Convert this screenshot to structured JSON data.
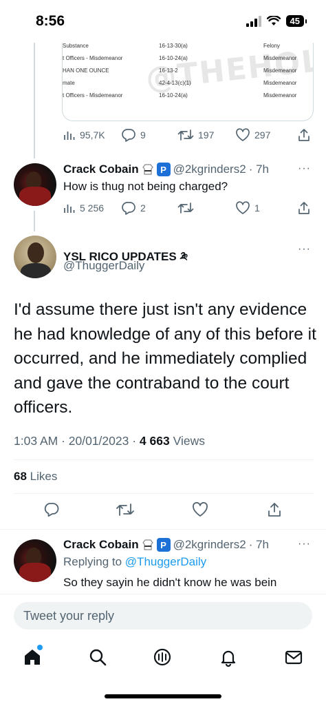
{
  "status_bar": {
    "time": "8:56",
    "battery": "45"
  },
  "media": {
    "watermark": "@THEHOLLOWBRO",
    "rows": [
      {
        "charge": "Substance",
        "code": "16-13-30(a)",
        "class": "Felony"
      },
      {
        "charge": "t Officers - Misdemeanor",
        "code": "16-10-24(a)",
        "class": "Misdemeanor"
      },
      {
        "charge": "HAN ONE OUNCE",
        "code": "16-13-2",
        "class": "Misdemeanor"
      },
      {
        "charge": "mate",
        "code": "42-4-13(c)(1)",
        "class": "Misdemeanor"
      },
      {
        "charge": "t Officers - Misdemeanor",
        "code": "16-10-24(a)",
        "class": "Misdemeanor"
      }
    ]
  },
  "first_tweet_actions": {
    "views": "95,7K",
    "replies": "9",
    "retweets": "197",
    "likes": "297"
  },
  "reply1": {
    "display_name": "Crack Cobain",
    "handle": "@2kgrinders2",
    "time": "· 7h",
    "text": "How is thug not being charged?",
    "views": "5 256",
    "replies": "2",
    "retweets": "",
    "likes": "1"
  },
  "main_tweet": {
    "display_name": "YSL RICO UPDATES ༬",
    "handle": "@ThuggerDaily",
    "text": "I'd assume there just isn't any evidence he had knowledge of any of this before it occurred, and he immediately complied and gave the contraband to the court officers.",
    "time": "1:03 AM · 20/01/2023 ·",
    "views_count": "4 663",
    "views_label": "Views",
    "likes_count": "68",
    "likes_label": "Likes"
  },
  "reply2": {
    "display_name": "Crack Cobain",
    "handle": "@2kgrinders2",
    "time": "· 7h",
    "replying_prefix": "Replying to",
    "replying_to": "@ThuggerDaily",
    "text": "So they sayin he didn't know he was bein"
  },
  "composer": {
    "placeholder": "Tweet your reply"
  },
  "more_label": "···",
  "colors": {
    "accent": "#1d9bf0",
    "muted": "#536471",
    "text": "#0f1419",
    "divider": "#eff3f4"
  }
}
